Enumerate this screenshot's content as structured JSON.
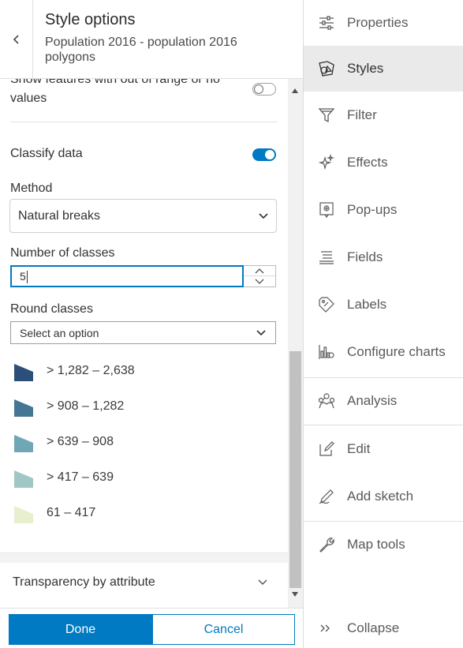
{
  "header": {
    "title": "Style options",
    "subtitle": "Population 2016 - population 2016 polygons"
  },
  "content": {
    "out_of_range_label_partial": "Show features with out of range or no",
    "out_of_range_label_line2": "values",
    "out_of_range_toggle": false,
    "classify_label": "Classify data",
    "classify_toggle": true,
    "method_label": "Method",
    "method_value": "Natural breaks",
    "num_classes_label": "Number of classes",
    "num_classes_value": "5",
    "round_label": "Round classes",
    "round_placeholder": "Select an option"
  },
  "legend": [
    {
      "label": "> 1,282 – 2,638",
      "color": "#2c4f7a"
    },
    {
      "label": "> 908 – 1,282",
      "color": "#457795"
    },
    {
      "label": "> 639 – 908",
      "color": "#6fa7b4"
    },
    {
      "label": "> 417 – 639",
      "color": "#9fc7c3"
    },
    {
      "label": "61 – 417",
      "color": "#e8efcf"
    }
  ],
  "transparency": {
    "label": "Transparency by attribute"
  },
  "footer": {
    "done_label": "Done",
    "cancel_label": "Cancel"
  },
  "nav": {
    "items": [
      {
        "label": "Properties",
        "icon": "sliders-icon"
      },
      {
        "label": "Styles",
        "icon": "styles-icon"
      },
      {
        "label": "Filter",
        "icon": "filter-icon"
      },
      {
        "label": "Effects",
        "icon": "sparkles-icon"
      },
      {
        "label": "Pop-ups",
        "icon": "popup-icon"
      },
      {
        "label": "Fields",
        "icon": "fields-icon"
      },
      {
        "label": "Labels",
        "icon": "label-icon"
      },
      {
        "label": "Configure charts",
        "icon": "chart-icon"
      },
      {
        "label": "Analysis",
        "icon": "analysis-icon"
      },
      {
        "label": "Edit",
        "icon": "edit-icon"
      },
      {
        "label": "Add sketch",
        "icon": "sketch-icon"
      },
      {
        "label": "Map tools",
        "icon": "wrench-icon"
      },
      {
        "label": "Collapse",
        "icon": "collapse-icon"
      }
    ],
    "active": "Styles"
  },
  "colors": {
    "accent": "#007ac2",
    "active_nav_bg": "#eaeaea"
  }
}
